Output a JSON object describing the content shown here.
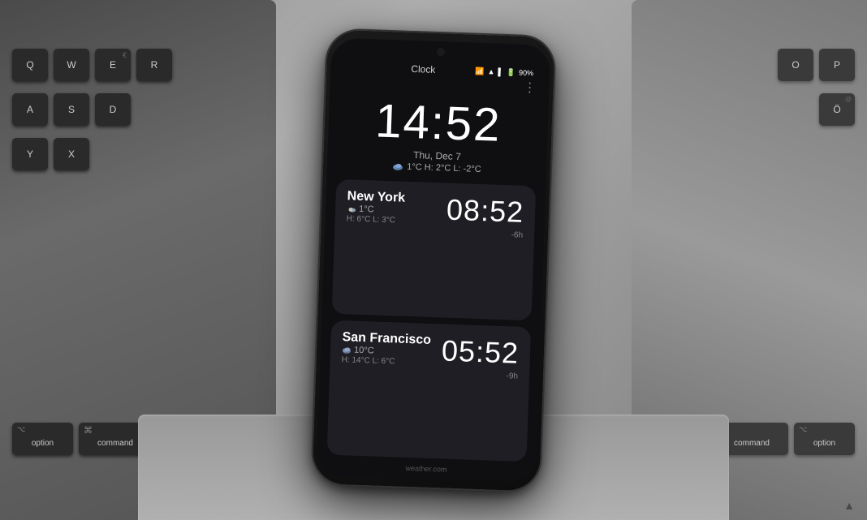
{
  "background": {
    "color": "#6a6a6a"
  },
  "left_keyboard": {
    "rows": [
      [
        "Q",
        "W",
        "E",
        "R"
      ],
      [
        "A",
        "S",
        "D"
      ],
      [
        "Y",
        "X"
      ]
    ]
  },
  "right_keyboard": {
    "rows": [
      [
        "O",
        "P"
      ],
      [
        "Ö"
      ],
      [
        "command",
        "option"
      ]
    ]
  },
  "phone": {
    "status_bar": {
      "app_name": "Clock",
      "battery": "90%",
      "icons": "⚡ ▲ 📶 🔋"
    },
    "main_clock": {
      "time": "14:52",
      "date": "Thu, Dec 7",
      "weather_icon": "cloud",
      "local_weather": "1°C  H: 2°C L: -2°C"
    },
    "cities": [
      {
        "name": "New York",
        "time": "08:52",
        "offset": "-6h",
        "weather_icon": "partly-cloudy",
        "temp": "1°C",
        "high_low": "H: 6°C L: 3°C"
      },
      {
        "name": "San Francisco",
        "time": "05:52",
        "offset": "-9h",
        "weather_icon": "cloudy",
        "temp": "10°C",
        "high_low": "H: 14°C L: 6°C"
      }
    ],
    "attribution": "weather.com"
  },
  "keyboard_keys": {
    "left": {
      "row1": [
        "Q",
        "W",
        "E",
        "R"
      ],
      "row2": [
        "A",
        "S",
        "D"
      ],
      "row3": [
        "Y",
        "X"
      ],
      "bottom": [
        "option",
        "command"
      ]
    },
    "right": {
      "row1": [
        "O",
        "P"
      ],
      "row2": [
        "Ö"
      ],
      "bottom": [
        "command",
        "option"
      ]
    }
  },
  "watermark": "▲"
}
